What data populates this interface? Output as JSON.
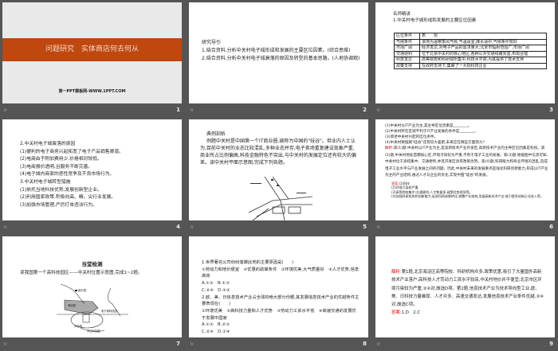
{
  "slides": [
    {
      "num": "1",
      "title": "问题研究　实体商店何去何从",
      "footer_text": "第一PPT模板网-WWW.1PPT.COM",
      "accent": "#c0470e"
    },
    {
      "num": "2",
      "heading": "研究导引",
      "lines": [
        "1.结合资料,分析中关村电子城形成和发展的主要区位因素。(综合思维)",
        "2.结合资料,分析中关村电子城衰落的原因及转型的基本思路。(人地协调观)"
      ]
    },
    {
      "num": "3",
      "heading": "名师精讲",
      "subheading": "1.中关村电子城形成和发展的主要区位因素",
      "table_header": [
        "区位条件",
        "表　　现"
      ],
      "rows": [
        [
          "气候条件",
          "该地为温带季风气候,气温适宜,降水适中,气候条件较好"
        ],
        [
          "市场广阔",
          "经济发达,对电子产品的需求量大;北京市辐射范围广,市场广阔"
        ],
        [
          "交通便利",
          "位于北京中关村的核心地区,各种公共交通线路完善,布局合理"
        ],
        [
          "科技发达",
          "高等院校和科研院所集中,科技水平高,为其提供了技术支持"
        ],
        [
          "政策支持",
          "在政府支持下,集聚了一大批科技企业"
        ]
      ]
    },
    {
      "num": "4",
      "lines": [
        "2.中关村电子城衰落的原因",
        "(1)便利的电子商务兴起拓宽了电子产品销售渠道。",
        "(2)电商由于附加费用少,价格相对较低。",
        "(3)电商报价透明,且服务不断完善。",
        "(4)电子城内商家的恶性竞争及不良市场行为。",
        "3.中关村电子城转型措施",
        "(1)依托当地科技优势,发展创新型企业。",
        "(2)利用国家政策,积极向高、精、尖行业发展。",
        "(3)加强市场管理,严厉打击违法行为。"
      ]
    },
    {
      "num": "5",
      "heading": "典例剖析",
      "body": "例题中关村是中国第一个IT商业圈,被称为中国的\"硅谷\"。但业内人士认为,目前中关村的业态比较混乱,多种业态并存,电子卖场重复建设现象严重,商业所占比例偏高,科技金融特色不突出,与中关村的发展定位还有较大的偏差。读中关村平面示意图,完成下列各题。"
    },
    {
      "num": "6",
      "questions": [
        "(1)中关村以IT产业为主,其主导区位因素是________。",
        "(2)中关村所在区域不利于IT产业发展的条件是________。",
        "(3)简述中关村兴起的区位条件。",
        "(4)中关村要摆脱\"硅谷\"还有较大差距,未来应在哪些方面努力?"
      ],
      "analysis_label": "解析:",
      "analysis": "第(1)题,中关村以IT产业为主,是高新技术产业开发区,高新技术产业的主导区位因素是科技。第(2)题,中关村地处首都核心区,环境污染较为严重,不利于电子工业的发展。第(3)题,根据图中信息可知,中关村位于高校集中、交通便利,并且开发区具有政策优势。第(4)题,科研能力和商业环境的混乱,造成电子工业水平与产业发展之间的问题。因此,中关村未来的发展重点是强化科研创新能力,形成以IT产业为主的产业结构,通过人才与企业的优化,实现中国\"硅谷\"的发展。",
      "answer_label": "答案:",
      "answers": [
        "(1)科技",
        "(2)环境污染较严重",
        "(3)高等院校集中;交通便利;人才数量多;政策优势明显等。",
        "(4)加强科研机构的创新能力,促进科研成果转化;调整产业结构,发展高新技术产业;吸引更多创新企业进入等。"
      ]
    },
    {
      "num": "7",
      "heading": "当堂检测",
      "body": "读我国第一个高科技园区——中关村位置示意图,完成1~2题。",
      "map_labels": [
        "昌平园",
        "海淀园",
        "电子城科技园",
        "丰台园",
        "亦庄科技园"
      ]
    },
    {
      "num": "8",
      "lines": [
        "1.世界著名公司纷纷落脚此地的主要原因是(　　)",
        "①劳动力和地价便宜　②优惠的政策条件　③环境优美,大气质量好　④人才优势,信息高效",
        "A.①②　B.①③",
        "C.②④　D.②③",
        "2.欧、美、日信息技术产业占全球的绝大部分份额,其发展信息技术产业的优越条件主要表现在(　　)",
        "①环境优美　②高科技力量和人才优势　③劳动力工资水平低　④高速交通的发展优于发展中国家",
        "A.①②　B.②③",
        "C.②④　D.①④"
      ]
    },
    {
      "num": "9",
      "analysis_label": "解析:",
      "analysis": "第1题,北京海淀区高等院校、科研机构众多,政策优惠,吸引了大量国外高新技术产业落户;高科技人才劳动力工资水平较高,中关村地价并不便宜;北京市区环境污染较为严重,②④对,故选D项。第2题,信息技术产业为技术导向型工业,欧、美、日科技力量雄厚、人才众多、高速交通发达,发展信息技术产业条件优越,②④对,故选C项。",
      "answer_label": "答案:",
      "answer": "1.D　2.C"
    }
  ],
  "footer_icon": "animation-icon"
}
